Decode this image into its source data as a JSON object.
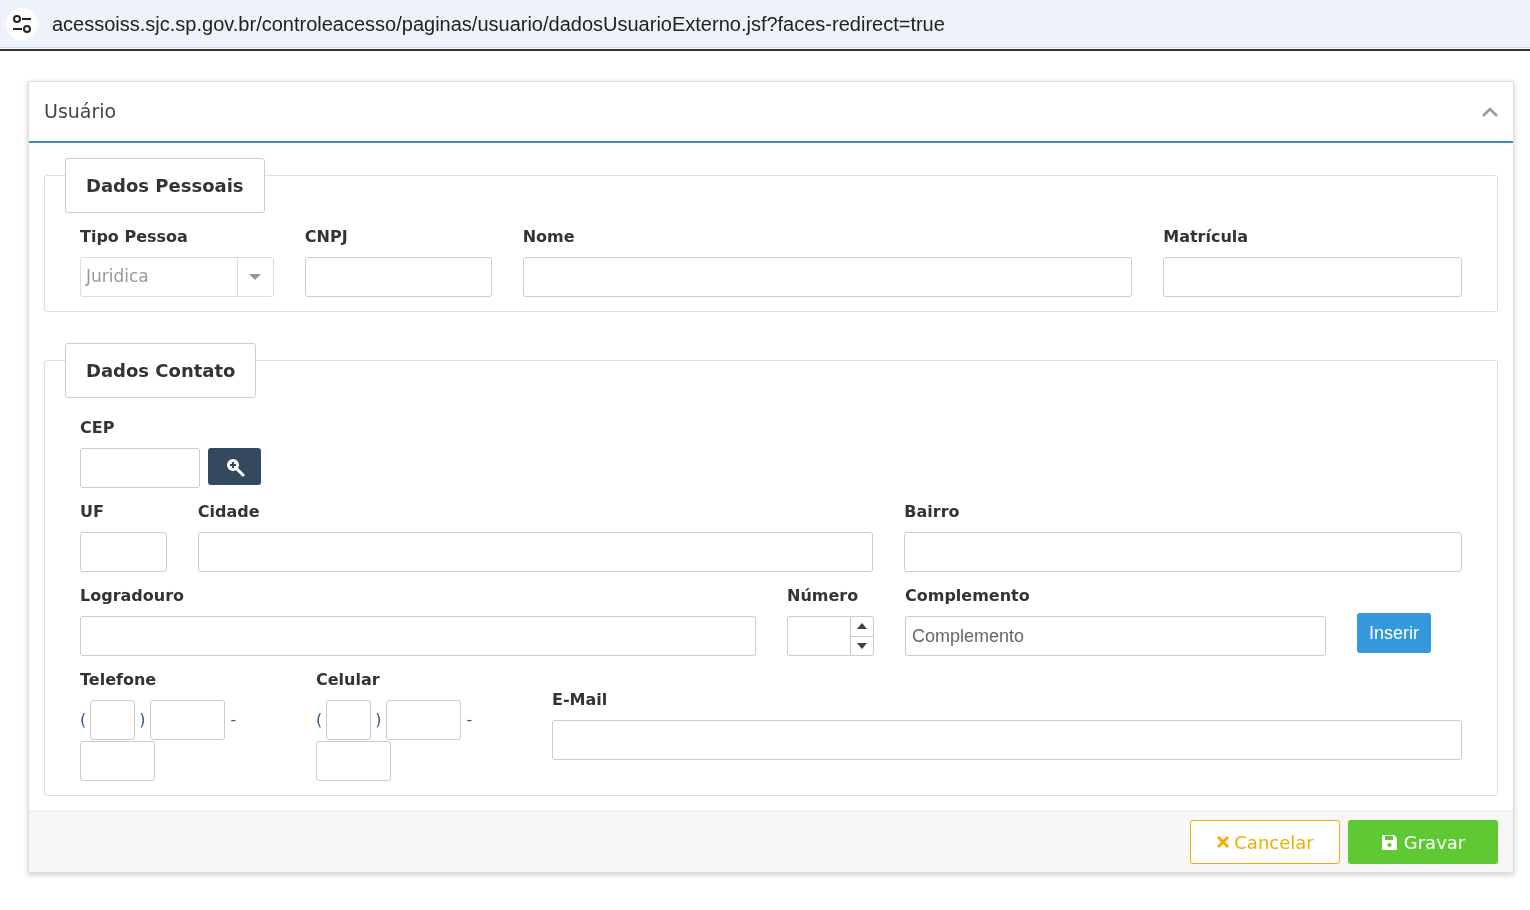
{
  "browser": {
    "url": "acessoiss.sjc.sp.gov.br/controleacesso/paginas/usuario/dadosUsuarioExterno.jsf?faces-redirect=true"
  },
  "panel": {
    "title": "Usuário",
    "expanded": true
  },
  "sections": [
    {
      "legend": "Dados Pessoais",
      "rows": [
        [
          {
            "kind": "select",
            "label": "Tipo Pessoa",
            "value": "Juridica"
          },
          {
            "kind": "text",
            "label": "CNPJ"
          },
          {
            "kind": "text",
            "label": "Nome"
          },
          {
            "kind": "text",
            "label": "Matrícula"
          }
        ]
      ]
    },
    {
      "legend": "Dados Contato",
      "rows": [
        [
          {
            "kind": "search",
            "label": "CEP"
          }
        ],
        [
          {
            "kind": "text",
            "label": "UF"
          },
          {
            "kind": "text",
            "label": "Cidade"
          },
          {
            "kind": "text",
            "label": "Bairro"
          }
        ],
        [
          {
            "kind": "text",
            "label": "Logradouro"
          },
          {
            "kind": "number",
            "label": "Número"
          },
          {
            "kind": "text",
            "label": "Complemento",
            "placeholder": "Complemento"
          },
          {
            "kind": "button",
            "label": "Inserir"
          }
        ],
        [
          {
            "kind": "phone",
            "label": "Telefone",
            "open": "(",
            "close": ")",
            "dash": "-"
          },
          {
            "kind": "phone",
            "label": "Celular",
            "open": "(",
            "close": ")",
            "dash": "-"
          },
          {
            "kind": "text",
            "label": "E-Mail"
          }
        ]
      ]
    }
  ],
  "footer_buttons": [
    {
      "kind": "cancel",
      "label": "Cancelar"
    },
    {
      "kind": "save",
      "label": "Gravar"
    }
  ]
}
